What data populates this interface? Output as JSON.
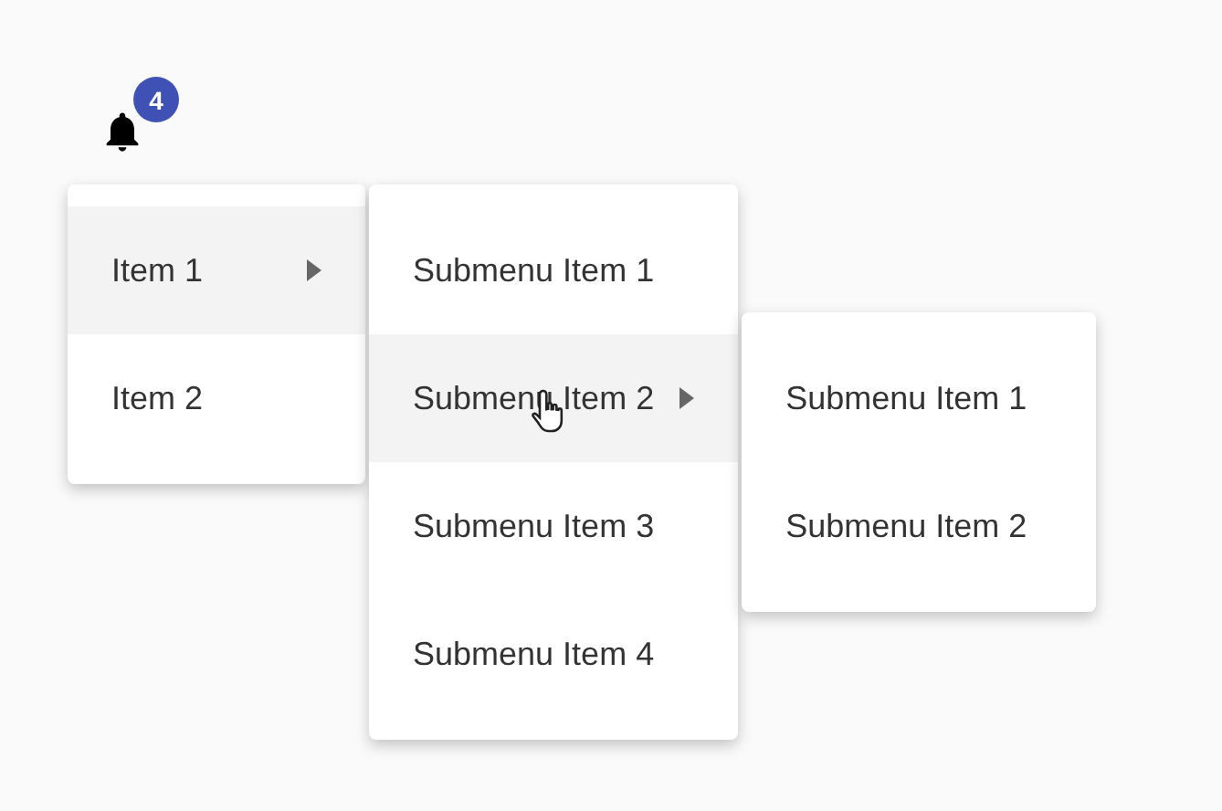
{
  "notifications": {
    "badge": "4"
  },
  "menu": {
    "items": [
      {
        "label": "Item 1",
        "selected": true,
        "children": [
          {
            "label": "Submenu Item 1",
            "selected": false
          },
          {
            "label": "Submenu Item 2",
            "selected": true,
            "children": [
              {
                "label": "Submenu Item 1",
                "selected": false
              },
              {
                "label": "Submenu Item 2",
                "selected": false
              }
            ]
          },
          {
            "label": "Submenu Item 3",
            "selected": false
          },
          {
            "label": "Submenu Item 4",
            "selected": false
          }
        ]
      },
      {
        "label": "Item 2",
        "selected": false
      }
    ]
  }
}
